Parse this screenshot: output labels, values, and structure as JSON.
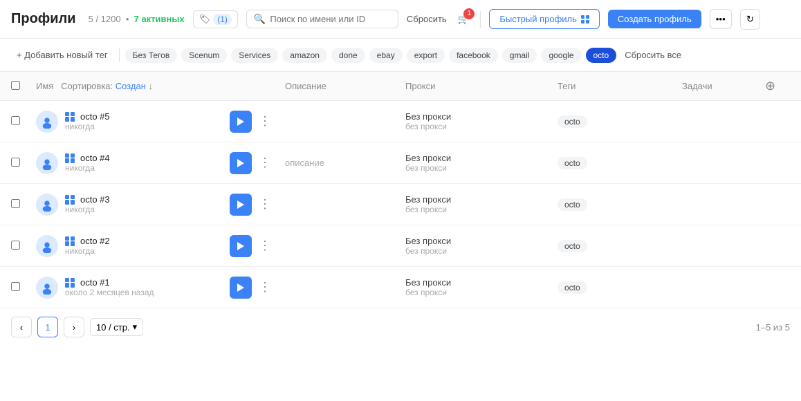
{
  "header": {
    "title": "Профили",
    "count": "5 / 1200",
    "active_label": "7 активных",
    "tag_icon_label": "(1)",
    "search_placeholder": "Поиск по имени или ID",
    "reset_label": "Сбросить",
    "cart_count": "1",
    "quick_profile_label": "Быстрый профиль",
    "create_profile_label": "Создать профиль",
    "refresh_icon": "↻"
  },
  "tags_bar": {
    "add_tag_label": "+ Добавить новый тег",
    "tags": [
      {
        "label": "Без Тегов",
        "active": false
      },
      {
        "label": "Scenum",
        "active": false
      },
      {
        "label": "Services",
        "active": false
      },
      {
        "label": "amazon",
        "active": false
      },
      {
        "label": "done",
        "active": false
      },
      {
        "label": "ebay",
        "active": false
      },
      {
        "label": "export",
        "active": false
      },
      {
        "label": "facebook",
        "active": false
      },
      {
        "label": "gmail",
        "active": false
      },
      {
        "label": "google",
        "active": false
      },
      {
        "label": "octo",
        "active": true
      }
    ],
    "reset_all_label": "Сбросить все"
  },
  "table": {
    "columns": {
      "name": "Имя",
      "sort_label": "Сортировка:",
      "sort_field": "Создан",
      "description": "Описание",
      "proxy": "Прокси",
      "tags": "Теги",
      "tasks": "Задачи"
    },
    "rows": [
      {
        "id": 5,
        "name": "octo #5",
        "sub": "никогда",
        "description": "",
        "proxy_main": "Без прокси",
        "proxy_sub": "без прокси",
        "tag": "octo"
      },
      {
        "id": 4,
        "name": "octo #4",
        "sub": "никогда",
        "description": "описание",
        "proxy_main": "Без прокси",
        "proxy_sub": "без прокси",
        "tag": "octo"
      },
      {
        "id": 3,
        "name": "octo #3",
        "sub": "никогда",
        "description": "",
        "proxy_main": "Без прокси",
        "proxy_sub": "без прокси",
        "tag": "octo"
      },
      {
        "id": 2,
        "name": "octo #2",
        "sub": "никогда",
        "description": "",
        "proxy_main": "Без прокси",
        "proxy_sub": "без прокси",
        "tag": "octo"
      },
      {
        "id": 1,
        "name": "octo #1",
        "sub": "около 2 месяцев назад",
        "description": "",
        "proxy_main": "Без прокси",
        "proxy_sub": "без прокси",
        "tag": "octo"
      }
    ]
  },
  "pagination": {
    "prev_icon": "‹",
    "current_page": "1",
    "next_icon": "›",
    "per_page": "10 / стр.",
    "total": "1–5 из 5"
  }
}
